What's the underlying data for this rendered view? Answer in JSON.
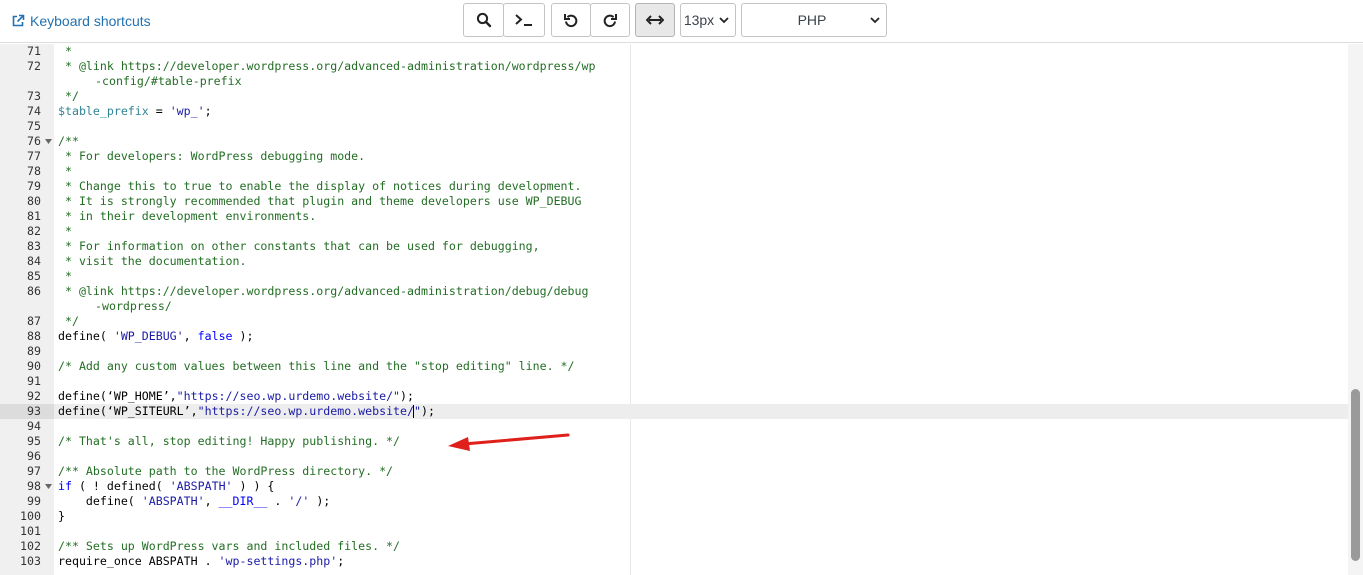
{
  "toolbar": {
    "shortcuts_label": "Keyboard shortcuts",
    "font_size": "13px",
    "language": "PHP",
    "icons": [
      "external-link-icon",
      "search-icon",
      "terminal-icon",
      "undo-icon",
      "redo-icon",
      "wrap-toggle-icon"
    ]
  },
  "colors": {
    "link": "#2271b1",
    "comment": "#236e24",
    "string": "#1a1aa6",
    "keyword": "#0000ff",
    "variable": "#318495",
    "annotation_arrow": "#e0201b"
  },
  "editor": {
    "active_line": "93",
    "lines": [
      {
        "num": "71",
        "tokens": [
          {
            "t": "comment",
            "v": " *"
          }
        ]
      },
      {
        "num": "72",
        "tokens": [
          {
            "t": "comment",
            "v": " * @link https://developer.wordpress.org/advanced-administration/wordpress/wp"
          }
        ]
      },
      {
        "num": "",
        "indent": true,
        "tokens": [
          {
            "t": "comment",
            "v": "-config/#table-prefix"
          }
        ]
      },
      {
        "num": "73",
        "tokens": [
          {
            "t": "comment",
            "v": " */"
          }
        ]
      },
      {
        "num": "74",
        "tokens": [
          {
            "t": "var",
            "v": "$table_prefix"
          },
          {
            "t": "plain",
            "v": " = "
          },
          {
            "t": "string",
            "v": "'wp_'"
          },
          {
            "t": "plain",
            "v": ";"
          }
        ]
      },
      {
        "num": "75",
        "tokens": []
      },
      {
        "num": "76",
        "fold": true,
        "tokens": [
          {
            "t": "comment",
            "v": "/**"
          }
        ]
      },
      {
        "num": "77",
        "tokens": [
          {
            "t": "comment",
            "v": " * For developers: WordPress debugging mode."
          }
        ]
      },
      {
        "num": "78",
        "tokens": [
          {
            "t": "comment",
            "v": " *"
          }
        ]
      },
      {
        "num": "79",
        "tokens": [
          {
            "t": "comment",
            "v": " * Change this to true to enable the display of notices during development."
          }
        ]
      },
      {
        "num": "80",
        "tokens": [
          {
            "t": "comment",
            "v": " * It is strongly recommended that plugin and theme developers use WP_DEBUG"
          }
        ]
      },
      {
        "num": "81",
        "tokens": [
          {
            "t": "comment",
            "v": " * in their development environments."
          }
        ]
      },
      {
        "num": "82",
        "tokens": [
          {
            "t": "comment",
            "v": " *"
          }
        ]
      },
      {
        "num": "83",
        "tokens": [
          {
            "t": "comment",
            "v": " * For information on other constants that can be used for debugging,"
          }
        ]
      },
      {
        "num": "84",
        "tokens": [
          {
            "t": "comment",
            "v": " * visit the documentation."
          }
        ]
      },
      {
        "num": "85",
        "tokens": [
          {
            "t": "comment",
            "v": " *"
          }
        ]
      },
      {
        "num": "86",
        "tokens": [
          {
            "t": "comment",
            "v": " * @link https://developer.wordpress.org/advanced-administration/debug/debug"
          }
        ]
      },
      {
        "num": "",
        "indent": true,
        "tokens": [
          {
            "t": "comment",
            "v": "-wordpress/"
          }
        ]
      },
      {
        "num": "87",
        "tokens": [
          {
            "t": "comment",
            "v": " */"
          }
        ]
      },
      {
        "num": "88",
        "tokens": [
          {
            "t": "plain",
            "v": "define( "
          },
          {
            "t": "string",
            "v": "'WP_DEBUG'"
          },
          {
            "t": "plain",
            "v": ", "
          },
          {
            "t": "keyword",
            "v": "false"
          },
          {
            "t": "plain",
            "v": " );"
          }
        ]
      },
      {
        "num": "89",
        "tokens": []
      },
      {
        "num": "90",
        "tokens": [
          {
            "t": "comment",
            "v": "/* Add any custom values between this line and the \"stop editing\" line. */"
          }
        ]
      },
      {
        "num": "91",
        "tokens": []
      },
      {
        "num": "92",
        "tokens": [
          {
            "t": "plain",
            "v": "define(‘WP_HOME’,"
          },
          {
            "t": "string",
            "v": "\"https://seo.wp.urdemo.website/\""
          },
          {
            "t": "plain",
            "v": ");"
          }
        ]
      },
      {
        "num": "93",
        "caret": true,
        "tokens": [
          {
            "t": "plain",
            "v": "define(‘WP_SITEURL’,"
          },
          {
            "t": "string",
            "v": "\"https://seo.wp.urdemo.website/"
          },
          {
            "t": "caret",
            "v": ""
          },
          {
            "t": "string",
            "v": "\""
          },
          {
            "t": "plain",
            "v": ");"
          }
        ]
      },
      {
        "num": "94",
        "tokens": []
      },
      {
        "num": "95",
        "tokens": [
          {
            "t": "comment",
            "v": "/* That's all, stop editing! Happy publishing. */"
          }
        ]
      },
      {
        "num": "96",
        "tokens": []
      },
      {
        "num": "97",
        "tokens": [
          {
            "t": "comment",
            "v": "/** Absolute path to the WordPress directory. */"
          }
        ]
      },
      {
        "num": "98",
        "fold": true,
        "tokens": [
          {
            "t": "keyword",
            "v": "if"
          },
          {
            "t": "plain",
            "v": " ( ! defined( "
          },
          {
            "t": "string",
            "v": "'ABSPATH'"
          },
          {
            "t": "plain",
            "v": " ) ) {"
          }
        ]
      },
      {
        "num": "99",
        "tokens": [
          {
            "t": "plain",
            "v": "    define( "
          },
          {
            "t": "string",
            "v": "'ABSPATH'"
          },
          {
            "t": "plain",
            "v": ", "
          },
          {
            "t": "const",
            "v": "__DIR__"
          },
          {
            "t": "plain",
            "v": " . "
          },
          {
            "t": "string",
            "v": "'/'"
          },
          {
            "t": "plain",
            "v": " );"
          }
        ]
      },
      {
        "num": "100",
        "tokens": [
          {
            "t": "plain",
            "v": "}"
          }
        ]
      },
      {
        "num": "101",
        "tokens": []
      },
      {
        "num": "102",
        "tokens": [
          {
            "t": "comment",
            "v": "/** Sets up WordPress vars and included files. */"
          }
        ]
      },
      {
        "num": "103",
        "tokens": [
          {
            "t": "plain",
            "v": "require_once ABSPATH . "
          },
          {
            "t": "string",
            "v": "'wp-settings.php'"
          },
          {
            "t": "plain",
            "v": ";"
          }
        ]
      }
    ]
  }
}
